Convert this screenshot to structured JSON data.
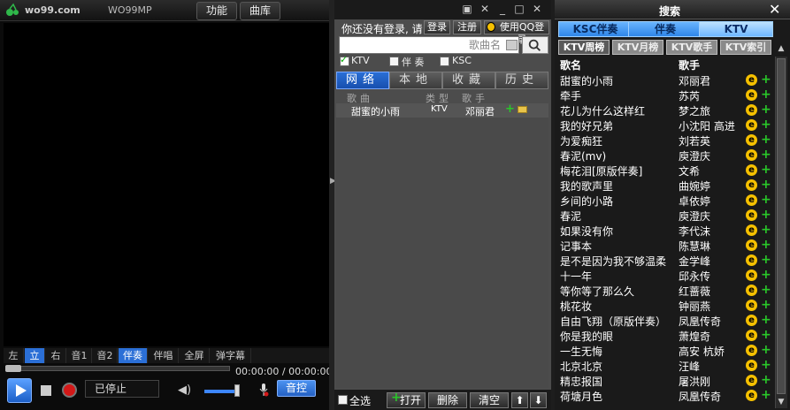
{
  "player": {
    "logo_text": "wo99.com",
    "window_title": "WO99MP",
    "menu": [
      {
        "label": "功能"
      },
      {
        "label": "曲库"
      }
    ],
    "channels": [
      {
        "label": "左"
      },
      {
        "label": "立"
      },
      {
        "label": "右"
      },
      {
        "label": "音1"
      },
      {
        "label": "音2"
      },
      {
        "label": "伴奏"
      },
      {
        "label": "伴唱"
      },
      {
        "label": "全屏"
      },
      {
        "label": "弹字幕"
      }
    ],
    "active_channels": [
      "立",
      "伴奏"
    ],
    "time": "00:00:00 / 00:00:00",
    "status": "已停止",
    "sound_control": "音控",
    "volume_percent": 80
  },
  "library": {
    "window_controls": [
      "▣",
      "✕",
      "_",
      "□",
      "✕"
    ],
    "login_text": "你还没有登录, 请",
    "login_btn": "登录",
    "register_btn": "注册",
    "qq_btn": "使用QQ登录",
    "search": {
      "placeholder": "",
      "field": "歌曲名"
    },
    "filters": [
      {
        "label": "KTV",
        "checked": true
      },
      {
        "label": "伴 奏",
        "checked": false
      },
      {
        "label": "KSC",
        "checked": false
      }
    ],
    "tabs": [
      {
        "label": "网络"
      },
      {
        "label": "本地"
      },
      {
        "label": "收藏"
      },
      {
        "label": "历史"
      }
    ],
    "headers": {
      "song": "歌曲",
      "type": "类型",
      "singer": "歌手"
    },
    "rows": [
      {
        "song": "甜蜜的小雨",
        "type": "KTV",
        "singer": "邓丽君"
      }
    ],
    "bottom": {
      "select_all": "全选",
      "open": "打开",
      "delete": "删除",
      "clear": "清空"
    }
  },
  "search_panel": {
    "title": "搜索",
    "close": "✕",
    "tabs": [
      {
        "label": "KSC伴奏"
      },
      {
        "label": "伴奏"
      },
      {
        "label": "KTV"
      }
    ],
    "subtabs": [
      {
        "label": "KTV周榜"
      },
      {
        "label": "KTV月榜"
      },
      {
        "label": "KTV歌手"
      },
      {
        "label": "KTV索引"
      }
    ],
    "headers": {
      "name": "歌名",
      "singer": "歌手"
    },
    "rows": [
      {
        "name": "甜蜜的小雨",
        "singer": "邓丽君"
      },
      {
        "name": "牵手",
        "singer": "苏芮"
      },
      {
        "name": "花儿为什么这样红",
        "singer": "梦之旅"
      },
      {
        "name": "我的好兄弟",
        "singer": "小沈阳 高进"
      },
      {
        "name": "为爱痴狂",
        "singer": "刘若英"
      },
      {
        "name": "春泥(mv)",
        "singer": "庾澄庆"
      },
      {
        "name": "梅花泪[原版伴奏]",
        "singer": "文希"
      },
      {
        "name": "我的歌声里",
        "singer": "曲婉婷"
      },
      {
        "name": "乡间的小路",
        "singer": "卓依婷"
      },
      {
        "name": "春泥",
        "singer": "庾澄庆"
      },
      {
        "name": "如果没有你",
        "singer": "李代沫"
      },
      {
        "name": "记事本",
        "singer": "陈慧琳"
      },
      {
        "name": "是不是因为我不够温柔",
        "singer": "金学峰"
      },
      {
        "name": "十一年",
        "singer": "邱永传"
      },
      {
        "name": "等你等了那么久",
        "singer": "红蔷薇"
      },
      {
        "name": "桃花妆",
        "singer": "钟丽燕"
      },
      {
        "name": "自由飞翔（原版伴奏）",
        "singer": "凤凰传奇"
      },
      {
        "name": "你是我的眼",
        "singer": "萧煌奇"
      },
      {
        "name": "一生无悔",
        "singer": "高安 杭娇"
      },
      {
        "name": "北京北京",
        "singer": "汪峰"
      },
      {
        "name": "精忠报国",
        "singer": "屠洪刚"
      },
      {
        "name": "荷塘月色",
        "singer": "凤凰传奇"
      }
    ]
  },
  "colors": {
    "accent": "#2b6fd6",
    "add": "#29c729",
    "e_icon": "#f5c000",
    "record": "#d31818"
  }
}
